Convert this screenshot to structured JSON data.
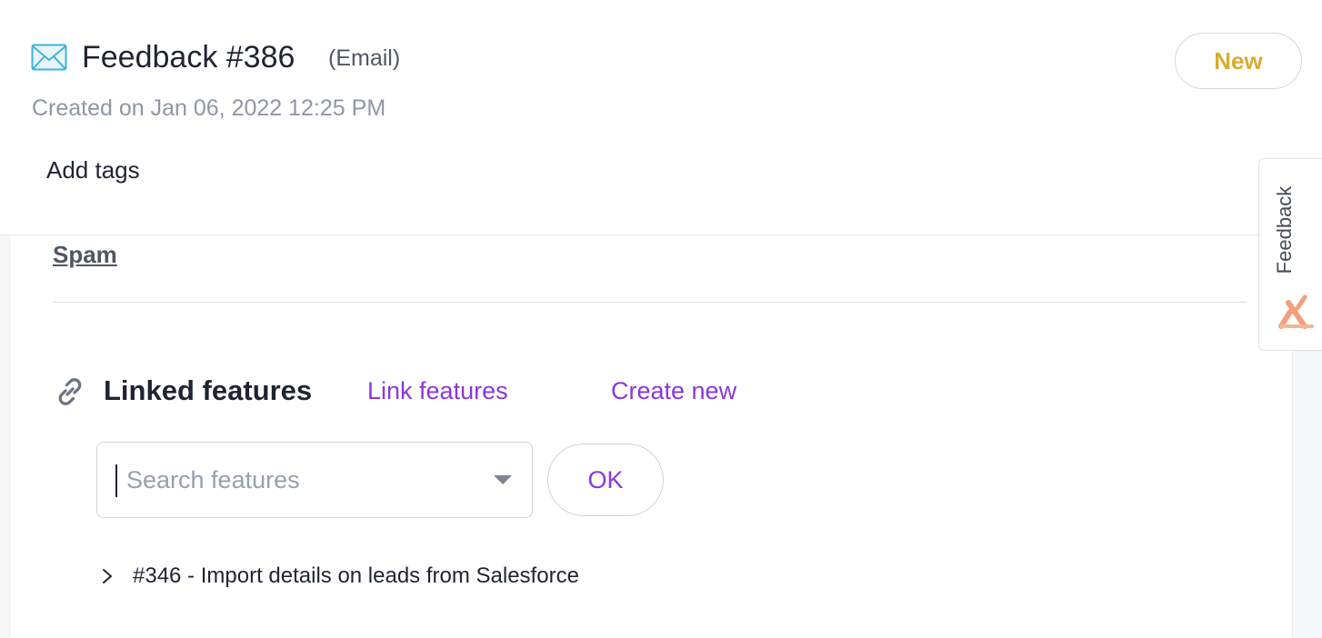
{
  "header": {
    "mail_icon": "envelope-icon",
    "title": "Feedback #386",
    "source": "(Email)",
    "created": "Created on Jan 06, 2022 12:25 PM",
    "add_tags": "Add tags",
    "status": "New",
    "status_color": "#d9ab2f"
  },
  "content": {
    "spam_label": "Spam",
    "linked_features": {
      "icon": "link-icon",
      "title": "Linked features",
      "link_action": "Link features",
      "create_action": "Create new",
      "action_color": "#8a36dd",
      "search_placeholder": "Search features",
      "search_value": "",
      "ok_label": "OK",
      "items": [
        {
          "label": "#346 - Import details on leads from Salesforce"
        }
      ]
    }
  },
  "side_tab": {
    "label": "Feedback",
    "logo_icon": "feedback-logo-icon"
  }
}
